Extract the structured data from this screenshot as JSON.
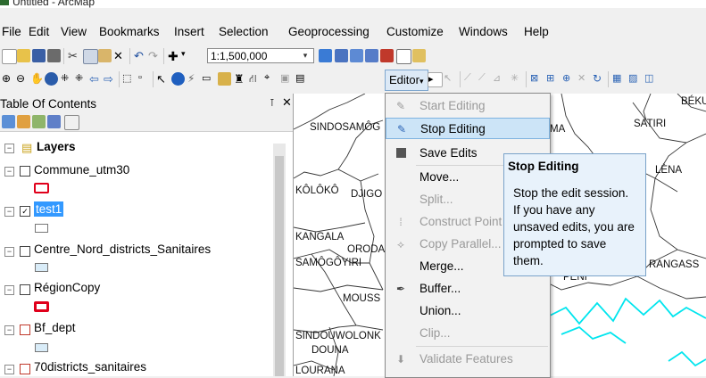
{
  "window": {
    "title": "Untitled - ArcMap"
  },
  "menubar": {
    "items": [
      "File",
      "Edit",
      "View",
      "Bookmarks",
      "Insert",
      "Selection",
      "Geoprocessing",
      "Customize",
      "Windows",
      "Help"
    ]
  },
  "toolbar": {
    "scale_value": "1:1,500,000",
    "editor_label": "Editor"
  },
  "toc": {
    "title": "Table Of Contents",
    "root_label": "Layers",
    "layers": [
      {
        "label": "Commune_utm30",
        "checked": false
      },
      {
        "label": "test1",
        "checked": true
      },
      {
        "label": "Centre_Nord_districts_Sanitaires",
        "checked": false
      },
      {
        "label": "RégionCopy",
        "checked": false
      },
      {
        "label": "Bf_dept",
        "checked": false
      },
      {
        "label": "70districts_sanitaires",
        "checked": false
      }
    ]
  },
  "editor_menu": {
    "items": [
      {
        "label": "Start Editing",
        "enabled": false,
        "icon": "pencil-icon"
      },
      {
        "label": "Stop Editing",
        "enabled": true,
        "icon": "stop-edit-icon"
      },
      {
        "label": "Save Edits",
        "enabled": true,
        "icon": "save-icon"
      },
      {
        "label": "Move...",
        "enabled": true,
        "icon": ""
      },
      {
        "label": "Split...",
        "enabled": false,
        "icon": ""
      },
      {
        "label": "Construct Point",
        "enabled": false,
        "icon": "construct-icon"
      },
      {
        "label": "Copy Parallel...",
        "enabled": false,
        "icon": "parallel-icon"
      },
      {
        "label": "Merge...",
        "enabled": true,
        "icon": ""
      },
      {
        "label": "Buffer...",
        "enabled": true,
        "icon": "buffer-icon"
      },
      {
        "label": "Union...",
        "enabled": true,
        "icon": ""
      },
      {
        "label": "Clip...",
        "enabled": false,
        "icon": ""
      },
      {
        "label": "Validate Features",
        "enabled": false,
        "icon": "validate-icon"
      }
    ]
  },
  "tooltip": {
    "title": "Stop Editing",
    "lines": [
      "Stop the edit session.",
      "If you have any",
      "unsaved edits, you are",
      "prompted to save",
      "them."
    ]
  },
  "map": {
    "labels": [
      "SINDOSAMÔG",
      "KÔLÔKÔ",
      "DJIGO",
      "KANGALA",
      "ORODA",
      "SAMÔGÔYIRI",
      "MOUSS",
      "SINDOUWOLONK",
      "DOUNA",
      "LOURANA",
      "SATIRI",
      "BÉKU",
      "LÈNA",
      "RANGASS",
      "MA",
      "PENI"
    ]
  },
  "colors": {
    "accent": "#7fb3e0",
    "selection_bg": "#3399ff",
    "river": "#00e5ee",
    "red_symbol": "#e0001b"
  }
}
